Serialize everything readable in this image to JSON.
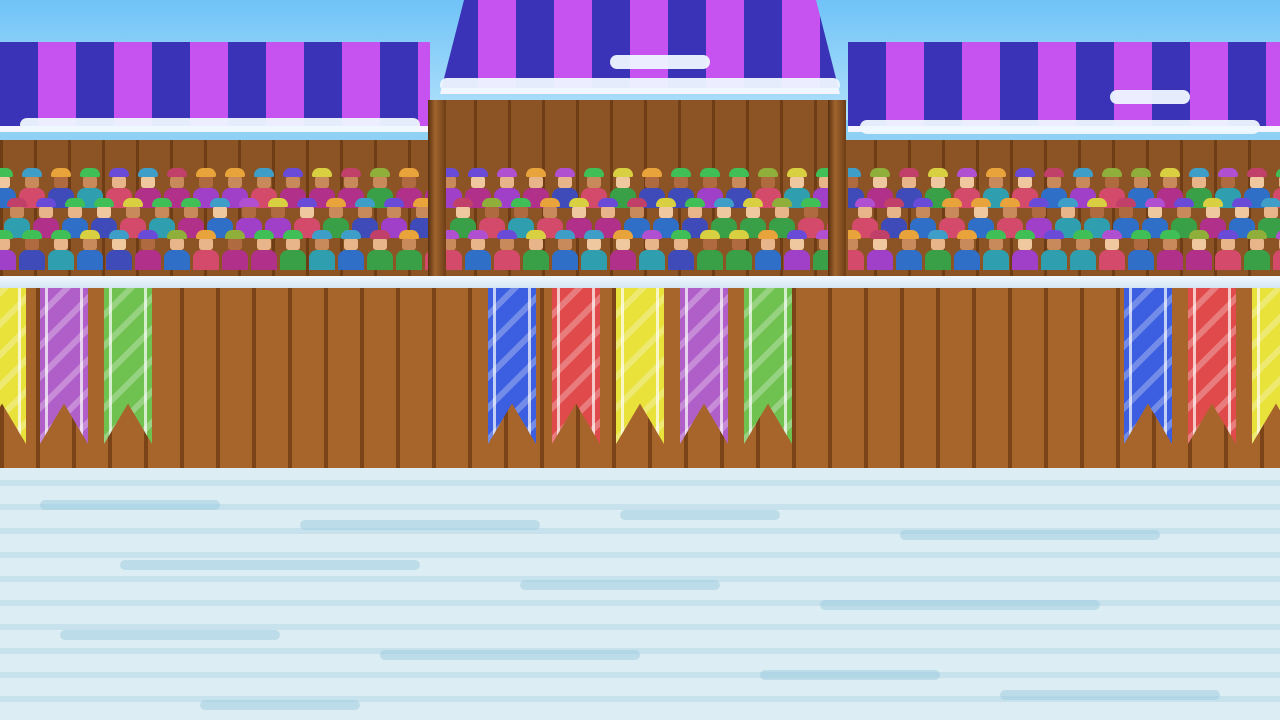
{
  "scene": {
    "colors": {
      "canopy_dark": "#3a33b8",
      "canopy_light": "#c652f0",
      "wood": "#a7652c",
      "snow": "#dcedf3",
      "sky": "#8fd0f5"
    },
    "banners": [
      {
        "color": "#e8e23a",
        "name": "yellow"
      },
      {
        "color": "#b05fc9",
        "name": "purple"
      },
      {
        "color": "#6fc150",
        "name": "green"
      },
      {
        "color": "#3b5fe0",
        "name": "blue"
      },
      {
        "color": "#e04a4a",
        "name": "red"
      },
      {
        "color": "#e8e23a",
        "name": "yellow"
      },
      {
        "color": "#b05fc9",
        "name": "purple"
      },
      {
        "color": "#6fc150",
        "name": "green"
      },
      {
        "color": "#3b5fe0",
        "name": "blue"
      },
      {
        "color": "#e04a4a",
        "name": "red"
      },
      {
        "color": "#e8e23a",
        "name": "yellow"
      }
    ],
    "spectator_hat_colors": [
      "#e8a43a",
      "#3f9ec8",
      "#b04fd0",
      "#3fbf55",
      "#c0406a",
      "#6a4bd8",
      "#8fae3a",
      "#d8d040"
    ],
    "spectator_body_colors": [
      "#2f6fc8",
      "#b0308a",
      "#3aa048",
      "#d44a6a",
      "#3f4bb8",
      "#2f9fb0",
      "#a040c8"
    ],
    "spectator_skin_colors": [
      "#e8b48a",
      "#c88a5a",
      "#f0c8a0",
      "#b06a40"
    ]
  }
}
